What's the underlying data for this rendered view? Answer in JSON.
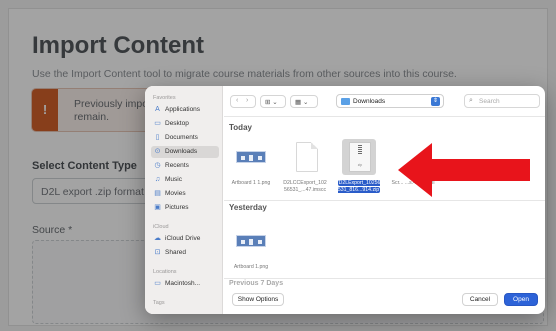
{
  "background": {
    "title": "Import Content",
    "subtitle": "Use the Import Content tool to migrate course materials from other sources into this course.",
    "alert_icon": "!",
    "alert_text": "Previously impo… remain.",
    "alert_text_line1": "Previously impo",
    "alert_text_line2": "remain.",
    "select_label": "Select Content Type",
    "select_value": "D2L export .zip format",
    "source_label": "Source *"
  },
  "dialog": {
    "sidebar": {
      "favorites_header": "Favorites",
      "items": [
        {
          "label": "Applications",
          "icon": "applications-icon"
        },
        {
          "label": "Desktop",
          "icon": "desktop-icon"
        },
        {
          "label": "Documents",
          "icon": "document-icon"
        },
        {
          "label": "Downloads",
          "icon": "download-icon"
        },
        {
          "label": "Recents",
          "icon": "clock-icon"
        },
        {
          "label": "Music",
          "icon": "music-icon"
        },
        {
          "label": "Movies",
          "icon": "movie-icon"
        },
        {
          "label": "Pictures",
          "icon": "picture-icon"
        }
      ],
      "icloud_header": "iCloud",
      "icloud_items": [
        {
          "label": "iCloud Drive",
          "icon": "cloud-icon"
        },
        {
          "label": "Shared",
          "icon": "shared-folder-icon"
        }
      ],
      "locations_header": "Locations",
      "locations_items": [
        {
          "label": "Macintosh...",
          "icon": "disk-icon"
        }
      ],
      "tags_header": "Tags"
    },
    "toolbar": {
      "location": "Downloads",
      "search_placeholder": "Search"
    },
    "groups": {
      "today": "Today",
      "yesterday": "Yesterday",
      "previous": "Previous 7 Days"
    },
    "files_today": [
      {
        "name": "Artboard 1 1.png"
      },
      {
        "name": "D2LCCExport_102 56531_...47.imscc"
      },
      {
        "name": "D2LExport_10256 531_816...914.zip",
        "selected": true
      },
      {
        "name": "Scr...  ...s.4...  ...ami"
      }
    ],
    "files_yesterday": [
      {
        "name": "Artboard 1.png"
      }
    ],
    "buttons": {
      "show_options": "Show Options",
      "cancel": "Cancel",
      "open": "Open"
    }
  },
  "colors": {
    "arrow": "#e8141b",
    "open_button": "#2d63d8",
    "alert_accent": "#d4622b"
  }
}
